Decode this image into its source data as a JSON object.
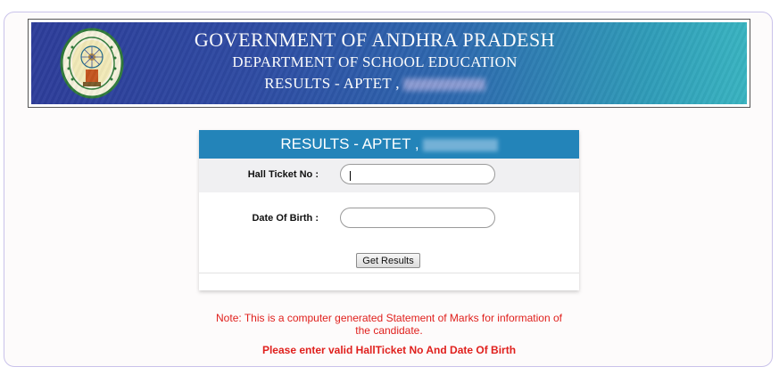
{
  "banner": {
    "line1": "GOVERNMENT OF ANDHRA PRADESH",
    "line2": "DEPARTMENT OF SCHOOL EDUCATION",
    "line3": "RESULTS - APTET ,",
    "seal_icon": "andhra-pradesh-government-seal"
  },
  "form": {
    "title": "RESULTS - APTET ,",
    "hall_ticket_label": "Hall Ticket No :",
    "hall_ticket_value": "",
    "dob_label": "Date Of Birth :",
    "dob_value": "",
    "submit_label": "Get Results"
  },
  "notes": {
    "statement": "Note: This is a computer generated Statement of Marks for information of the candidate.",
    "error": "Please enter valid HallTicket No And Date Of Birth"
  },
  "colors": {
    "header_blue": "#2384b9",
    "note_red": "#e0201d",
    "banner_dark": "#2d3d9a",
    "banner_light": "#39b4c1"
  }
}
